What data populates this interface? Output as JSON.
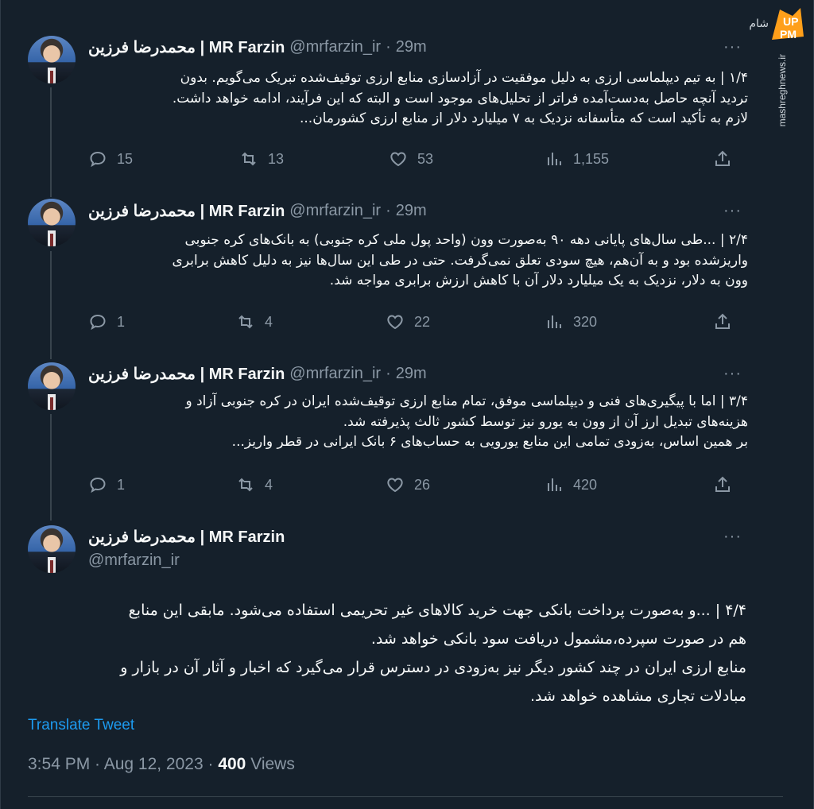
{
  "author": {
    "name": "محمدرضا فرزین | MR Farzin",
    "handle": "@mrfarzin_ir",
    "time": "29m",
    "dot": "·"
  },
  "tweets": [
    {
      "text_lines": [
        "۱/۴ | به تیم دیپلماسی ارزی به دلیل موفقیت در آزادسازی منابع ارزی توقیف‌شده تبریک می‌گویم. بدون",
        "تردید آنچه حاصل به‌دست‌آمده فراتر از تحلیل‌های موجود است و البته که این فرآیند، ادامه خواهد داشت.",
        "لازم به تأکید است که متأسفانه نزدیک به ۷ میلیارد دلار از منابع ارزی کشورمان..."
      ],
      "replies": "15",
      "retweets": "13",
      "likes": "53",
      "views": "1,155"
    },
    {
      "text_lines": [
        "۲/۴ | ...طی سال‌های پایانی دهه ۹۰ به‌صورت وون (واحد پول ملی کره جنوبی) به بانک‌های کره جنوبی",
        "واریزشده بود و به آن‌هم، هیچ سودی تعلق نمی‌گرفت. حتی در طی این سال‌ها نیز به دلیل کاهش برابری",
        "وون به دلار، نزدیک به یک میلیارد دلار آن با کاهش ارزش برابری مواجه شد."
      ],
      "replies": "1",
      "retweets": "4",
      "likes": "22",
      "views": "320"
    },
    {
      "text_lines": [
        "۳/۴ | اما با پیگیری‌های فنی و دیپلماسی موفق، تمام منابع ارزی توقیف‌شده ایران در کره جنوبی آزاد و",
        "هزینه‌های تبدیل ارز آن از وون به یورو نیز توسط کشور ثالث پذیرفته شد.",
        "بر همین اساس، به‌زودی تمامی این منابع یورویی به حساب‌های ۶ بانک ایرانی در قطر واریز..."
      ],
      "replies": "1",
      "retweets": "4",
      "likes": "26",
      "views": "420"
    }
  ],
  "main_tweet": {
    "text_lines": [
      "۴/۴ | ...و به‌صورت پرداخت بانکی جهت خرید کالاهای غیر تحریمی استفاده می‌شود. مابقی این منابع",
      "هم در صورت سپرده،مشمول دریافت سود بانکی خواهد شد.",
      "منابع ارزی ایران در چند کشور دیگر نیز به‌زودی در دسترس قرار می‌گیرد که اخبار و آثار آن در بازار و",
      "مبادلات تجاری مشاهده خواهد شد."
    ],
    "translate_label": "Translate Tweet",
    "timestamp": "3:54 PM · Aug 12, 2023 · ",
    "views_count": "400",
    "views_label": " Views"
  },
  "more_label": "···",
  "watermark": {
    "text": "mashreghnews.ir",
    "fa": "شام",
    "logo": "UP PM"
  },
  "colors": {
    "background": "#15202b",
    "secondary": "#8b98a5",
    "link": "#1d9bf0",
    "text": "#f7f9f9"
  },
  "icons": [
    "reply-icon",
    "retweet-icon",
    "like-icon",
    "views-icon",
    "share-icon",
    "more-icon"
  ]
}
